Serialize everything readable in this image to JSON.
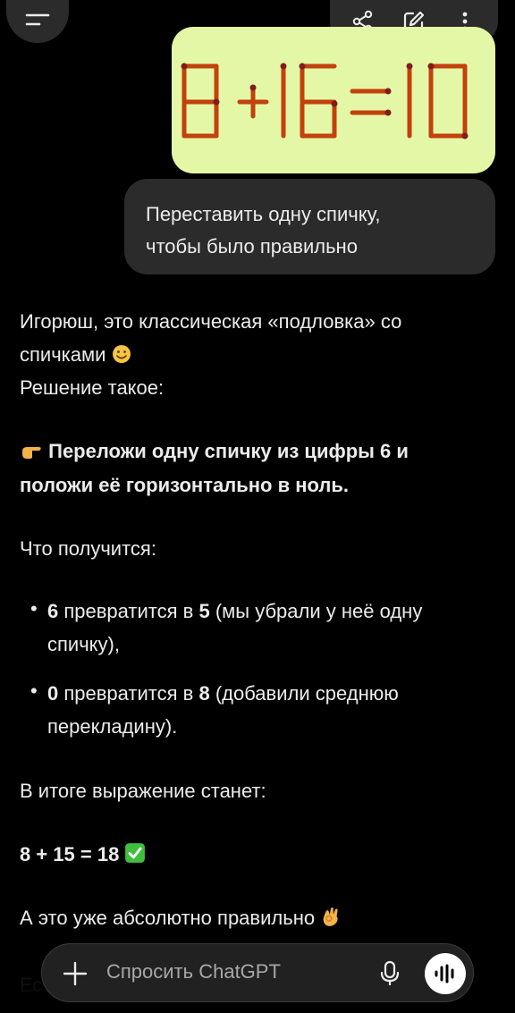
{
  "header": {
    "menu_icon": "menu-icon",
    "actions": [
      "share-icon",
      "edit-icon",
      "more-vertical-icon"
    ]
  },
  "user_message": {
    "image_caption": "8+16=10",
    "text_line1": "Переставить одну спичку,",
    "text_line2": "чтобы было правильно"
  },
  "assistant": {
    "line1": "Игорюш, это классическая «подловка» со",
    "line2": "спичками",
    "line3": "Решение такое:",
    "bold_line1": "Переложи одну спичку из цифры 6 и",
    "bold_line2": "положи её горизонтально в ноль.",
    "result_label": "Что получится:",
    "bullets": [
      {
        "bold": "6",
        "text": " превратится в ",
        "bold2": "5",
        "rest": " (мы убрали у неё одну",
        "cont": "спичку),"
      },
      {
        "bold": "0",
        "text": " превратится в ",
        "bold2": "8",
        "rest": " (добавили среднюю",
        "cont": "перекладину)."
      }
    ],
    "final_label": "В итоге выражение станет:",
    "equation": "8 + 15 = 18",
    "closing": "А это уже абсолютно правильно",
    "partial_hidden": "Ес"
  },
  "composer": {
    "placeholder": "Спросить ChatGPT",
    "plus_icon": "plus-icon",
    "mic_icon": "microphone-icon",
    "voice_icon": "voice-mode-icon"
  },
  "colors": {
    "background": "#000000",
    "bubble": "#2b2b2b",
    "image_bg": "#e3f7a6",
    "match_color": "#c2410c"
  }
}
